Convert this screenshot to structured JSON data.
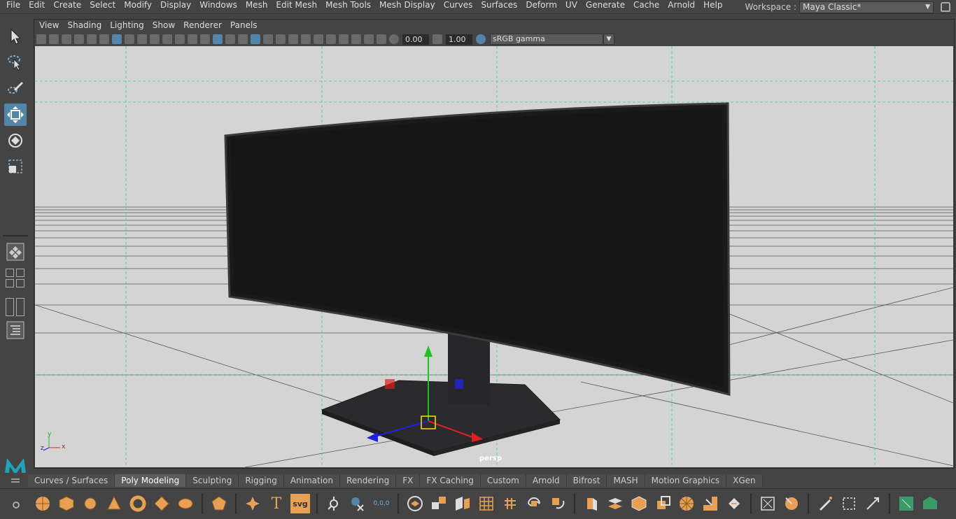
{
  "menubar": {
    "items": [
      "File",
      "Edit",
      "Create",
      "Select",
      "Modify",
      "Display",
      "Windows",
      "Mesh",
      "Edit Mesh",
      "Mesh Tools",
      "Mesh Display",
      "Curves",
      "Surfaces",
      "Deform",
      "UV",
      "Generate",
      "Cache",
      "Arnold",
      "Help"
    ]
  },
  "workspace": {
    "label": "Workspace :",
    "value": "Maya Classic*"
  },
  "panel": {
    "menus": [
      "View",
      "Shading",
      "Lighting",
      "Show",
      "Renderer",
      "Panels"
    ],
    "exposure": "0.00",
    "gamma": "1.00",
    "color_space": "sRGB gamma",
    "camera": "persp"
  },
  "axis": {
    "y": "y",
    "z": "z",
    "x": "x"
  },
  "shelf": {
    "tabs": [
      "Curves / Surfaces",
      "Poly Modeling",
      "Sculpting",
      "Rigging",
      "Animation",
      "Rendering",
      "FX",
      "FX Caching",
      "Custom",
      "Arnold",
      "Bifrost",
      "MASH",
      "Motion Graphics",
      "XGen"
    ],
    "active_tab": "Poly Modeling",
    "icon_text": {
      "text_tool": "T",
      "svg_tool": "svg",
      "snap_origin": "0,0,0"
    }
  },
  "colors": {
    "accent": "#5285a6",
    "shelf_orange": "#e8a055",
    "viewport_bg": "#d4d4d4",
    "x_axis": "#e02020",
    "y_axis": "#20c020",
    "z_axis": "#2020e0"
  }
}
